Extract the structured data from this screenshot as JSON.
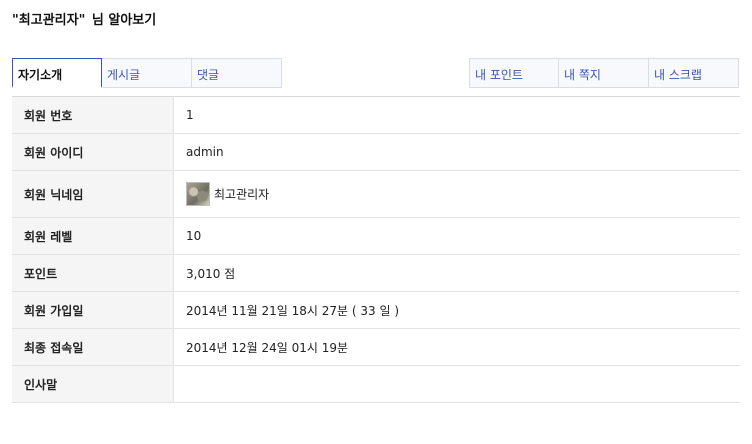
{
  "page": {
    "title_name": "\"최고관리자\"",
    "title_suffix": "님 알아보기"
  },
  "tabs_left": [
    {
      "label": "자기소개",
      "active": true
    },
    {
      "label": "게시글",
      "active": false
    },
    {
      "label": "댓글",
      "active": false
    }
  ],
  "tabs_right": [
    {
      "label": "내 포인트"
    },
    {
      "label": "내 쪽지"
    },
    {
      "label": "내 스크랩"
    }
  ],
  "rows": [
    {
      "label": "회원 번호",
      "value": "1"
    },
    {
      "label": "회원 아이디",
      "value": "admin"
    },
    {
      "label": "회원 닉네임",
      "value": "최고관리자",
      "avatar": true
    },
    {
      "label": "회원 레벨",
      "value": "10"
    },
    {
      "label": "포인트",
      "value": "3,010 점"
    },
    {
      "label": "회원 가입일",
      "value": "2014년 11월 21일 18시 27분 ( 33 일 )"
    },
    {
      "label": "최종 접속일",
      "value": "2014년 12월 24일 01시 19분"
    },
    {
      "label": "인사말",
      "value": ""
    }
  ]
}
